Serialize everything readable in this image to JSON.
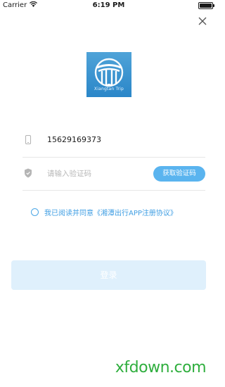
{
  "status_bar": {
    "carrier": "Carrier",
    "time": "6:19 PM"
  },
  "logo": {
    "text": "Xiangtan Trip"
  },
  "phone": {
    "value": "15629169373"
  },
  "code": {
    "placeholder": "请输入验证码",
    "get_code_label": "获取验证码"
  },
  "agreement": {
    "text": "我已阅读并同意《湘潭出行APP注册协议》"
  },
  "login": {
    "label": "登录"
  },
  "watermark": {
    "text": "xfdown.com"
  },
  "colors": {
    "accent": "#5ab4ef",
    "link": "#3f9ee3",
    "login_disabled_bg": "#dff0fc",
    "watermark": "#2fae3e"
  }
}
